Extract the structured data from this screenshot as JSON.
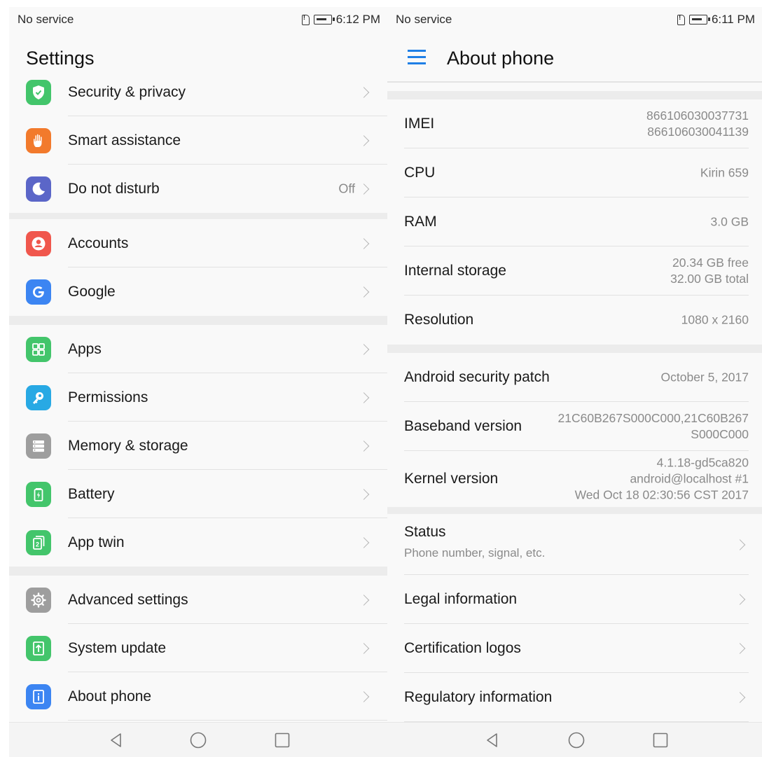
{
  "left": {
    "status_bar": {
      "carrier": "No service",
      "time": "6:12 PM"
    },
    "title": "Settings",
    "groups": [
      {
        "items": [
          {
            "label": "Security & privacy",
            "icon": "shield-icon",
            "color": "#43c56b"
          },
          {
            "label": "Smart assistance",
            "icon": "hand-icon",
            "color": "#f27a2c"
          },
          {
            "label": "Do not disturb",
            "icon": "moon-icon",
            "color": "#5b66c8",
            "value": "Off"
          }
        ]
      },
      {
        "items": [
          {
            "label": "Accounts",
            "icon": "account-icon",
            "color": "#f0574d"
          },
          {
            "label": "Google",
            "icon": "google-icon",
            "color": "#3c85f2"
          }
        ]
      },
      {
        "items": [
          {
            "label": "Apps",
            "icon": "apps-icon",
            "color": "#43c56b"
          },
          {
            "label": "Permissions",
            "icon": "key-icon",
            "color": "#28a9e4"
          },
          {
            "label": "Memory & storage",
            "icon": "storage-icon",
            "color": "#9e9e9e"
          },
          {
            "label": "Battery",
            "icon": "battery-icon",
            "color": "#43c56b"
          },
          {
            "label": "App twin",
            "icon": "app-twin-icon",
            "color": "#43c56b"
          }
        ]
      },
      {
        "items": [
          {
            "label": "Advanced settings",
            "icon": "gear-icon",
            "color": "#9e9e9e"
          },
          {
            "label": "System update",
            "icon": "system-update-icon",
            "color": "#43c56b"
          },
          {
            "label": "About phone",
            "icon": "info-icon",
            "color": "#3c85f2"
          }
        ]
      }
    ]
  },
  "right": {
    "status_bar": {
      "carrier": "No service",
      "time": "6:11 PM"
    },
    "title": "About phone",
    "info": [
      {
        "label": "IMEI",
        "value_lines": [
          "866106030037731",
          "866106030041139"
        ]
      },
      {
        "label": "CPU",
        "value_lines": [
          "Kirin 659"
        ]
      },
      {
        "label": "RAM",
        "value_lines": [
          "3.0 GB"
        ]
      },
      {
        "label": "Internal storage",
        "value_lines": [
          "20.34  GB free",
          "32.00  GB total"
        ]
      },
      {
        "label": "Resolution",
        "value_lines": [
          "1080 x 2160"
        ]
      }
    ],
    "software": [
      {
        "label": "Android security patch",
        "value_lines": [
          "October 5, 2017"
        ]
      },
      {
        "label": "Baseband version",
        "value_lines": [
          "21C60B267S000C000,21C60B267",
          "S000C000"
        ]
      },
      {
        "label": "Kernel version",
        "value_lines": [
          "4.1.18-gd5ca820",
          "android@localhost #1",
          "Wed Oct 18 02:30:56 CST 2017"
        ]
      }
    ],
    "status": {
      "title": "Status",
      "subtitle": "Phone number, signal, etc."
    },
    "links": [
      "Legal information",
      "Certification logos",
      "Regulatory information"
    ]
  },
  "nav_bar": {
    "buttons": [
      "back-icon",
      "home-icon",
      "recents-icon"
    ]
  }
}
